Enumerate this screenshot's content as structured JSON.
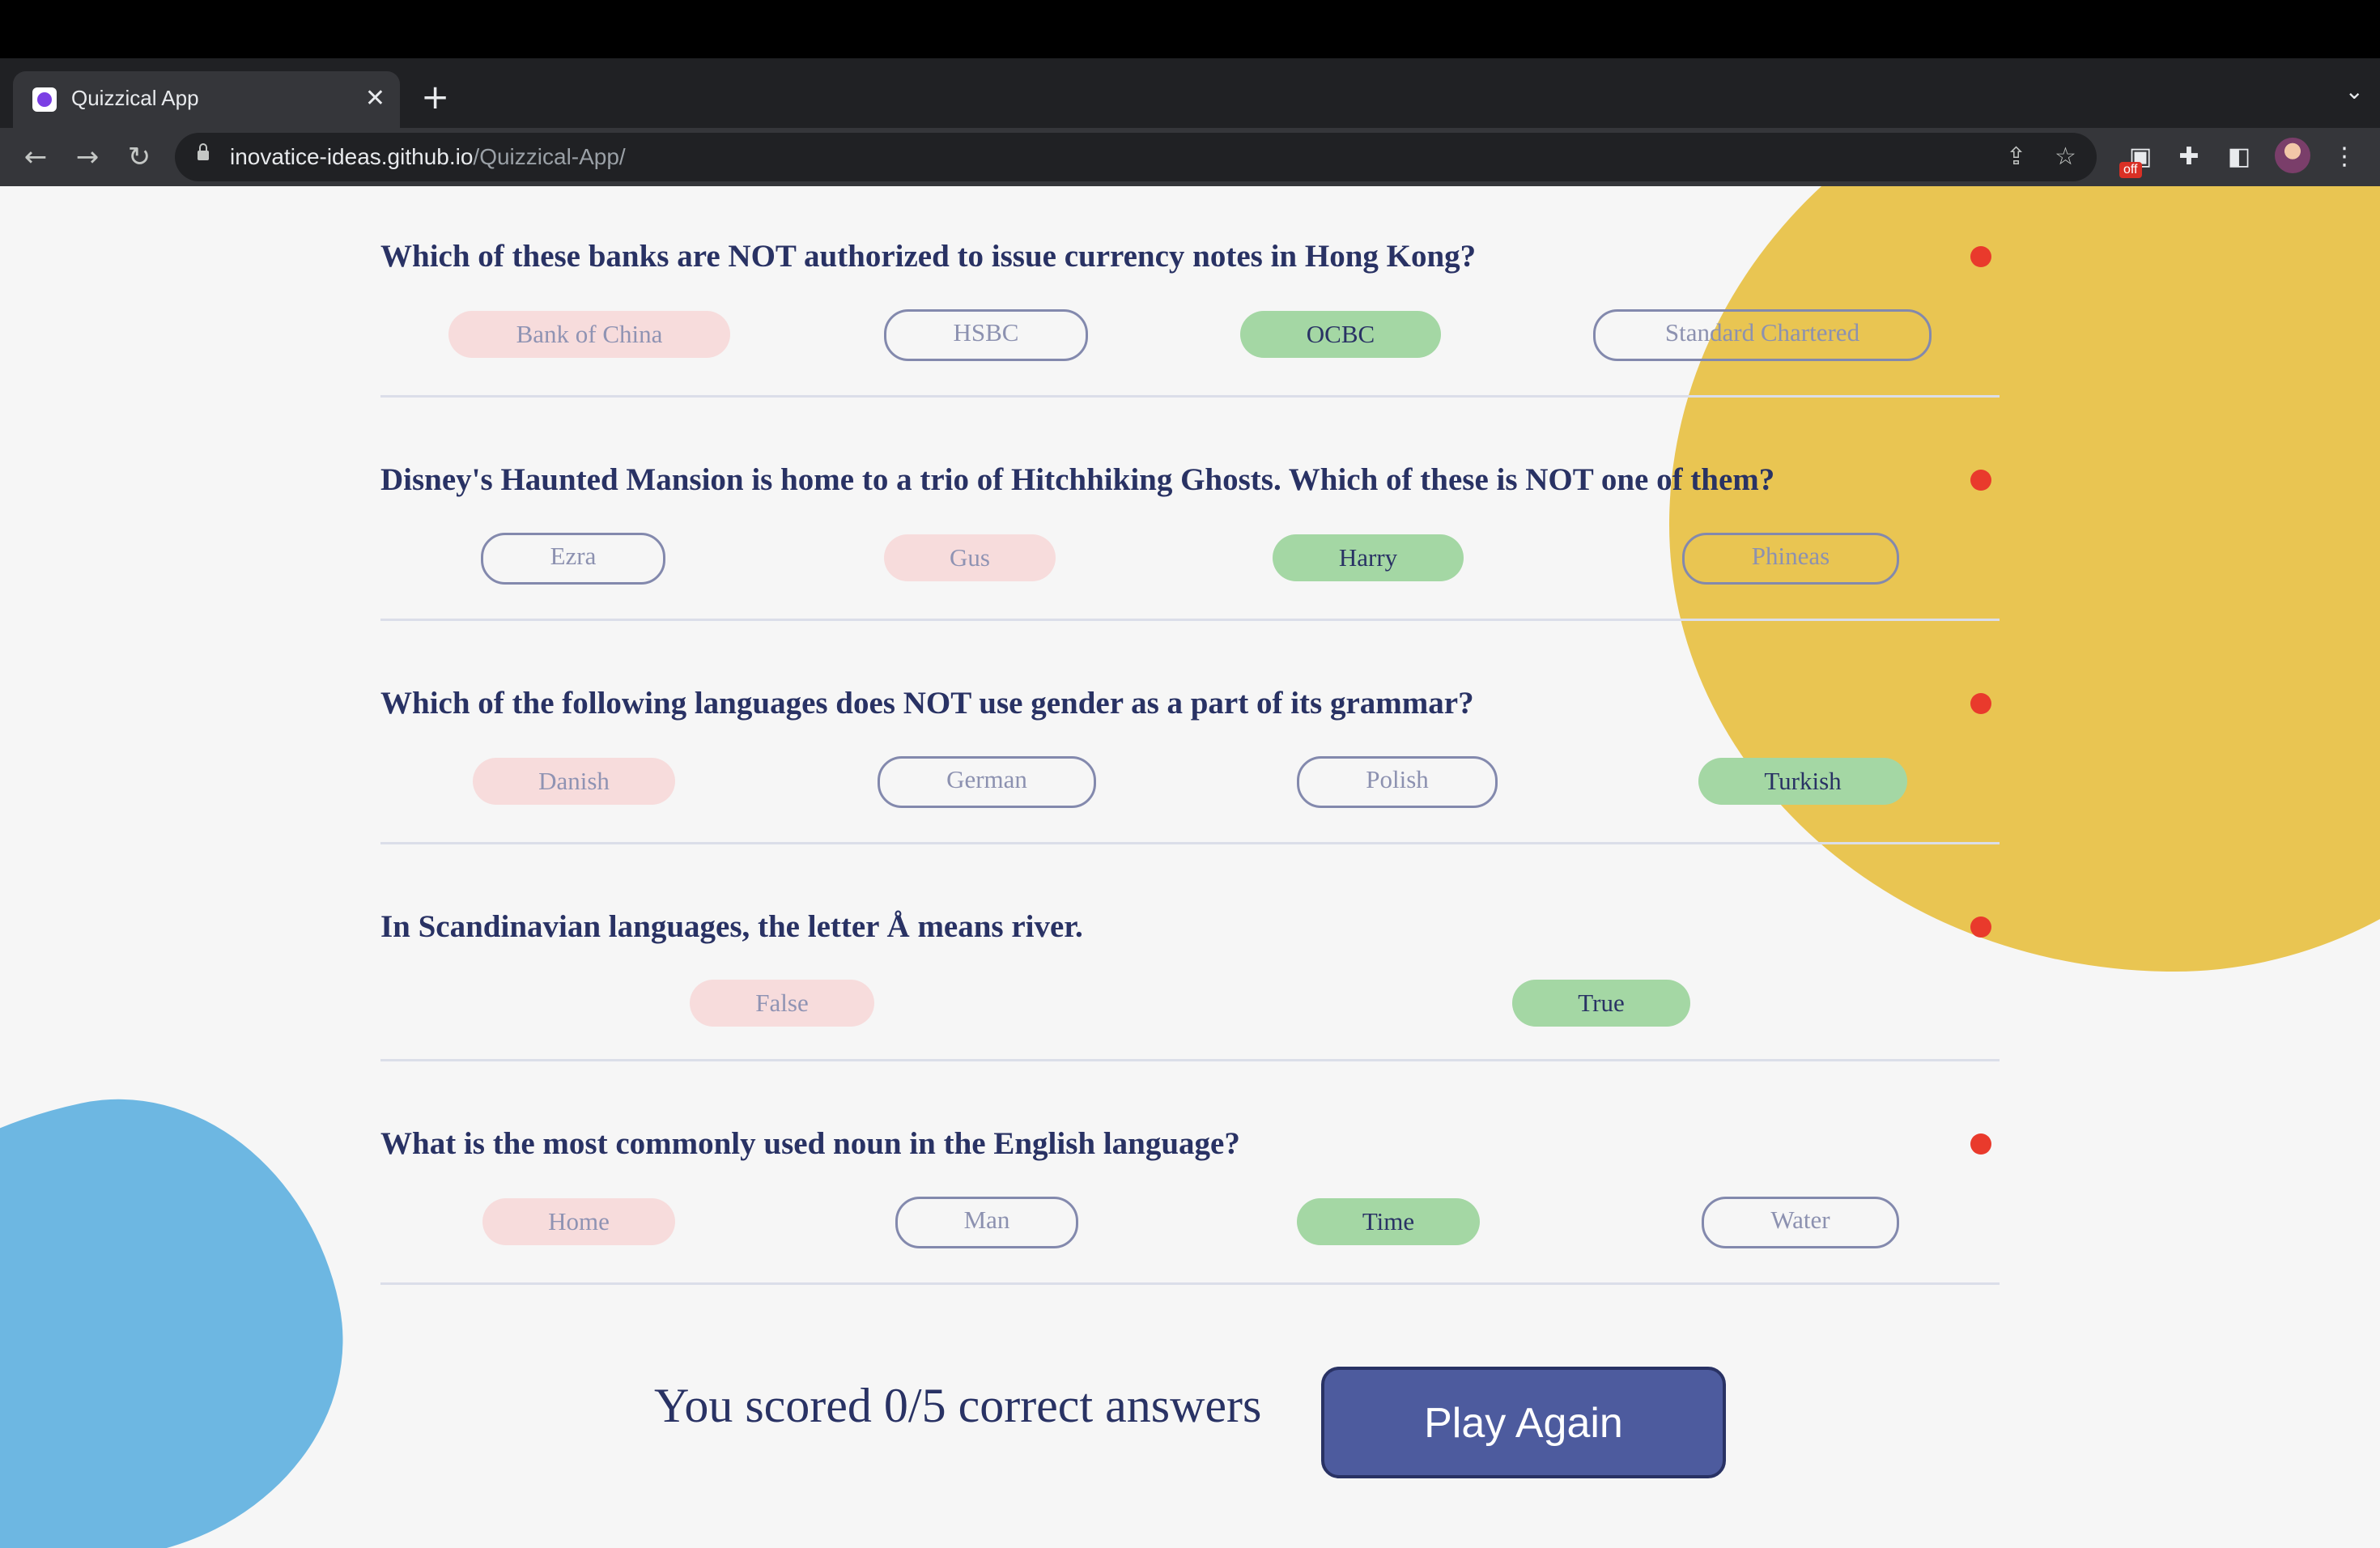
{
  "browser": {
    "tab_title": "Quizzical App",
    "new_tab_label": "+",
    "tab_close_label": "✕",
    "url_host": "inovatice-ideas.github.io",
    "url_path": "/Quizzical-App/",
    "extension_badge": "off"
  },
  "questions": [
    {
      "text": "Which of these banks are NOT authorized to issue currency notes in Hong Kong?",
      "answers": [
        {
          "label": "Bank of China",
          "state": "wrong"
        },
        {
          "label": "HSBC",
          "state": "neutral"
        },
        {
          "label": "OCBC",
          "state": "correct"
        },
        {
          "label": "Standard Chartered",
          "state": "neutral"
        }
      ]
    },
    {
      "text": "Disney's Haunted Mansion is home to a trio of Hitchhiking Ghosts. Which of these is NOT one of them?",
      "answers": [
        {
          "label": "Ezra",
          "state": "neutral"
        },
        {
          "label": "Gus",
          "state": "wrong"
        },
        {
          "label": "Harry",
          "state": "correct"
        },
        {
          "label": "Phineas",
          "state": "neutral"
        }
      ]
    },
    {
      "text": "Which of the following languages does NOT use gender as a part of its grammar?",
      "answers": [
        {
          "label": "Danish",
          "state": "wrong"
        },
        {
          "label": "German",
          "state": "neutral"
        },
        {
          "label": "Polish",
          "state": "neutral"
        },
        {
          "label": "Turkish",
          "state": "correct"
        }
      ]
    },
    {
      "text": "In Scandinavian languages, the letter Å means river.",
      "answers": [
        {
          "label": "False",
          "state": "wrong"
        },
        {
          "label": "True",
          "state": "correct"
        }
      ]
    },
    {
      "text": "What is the most commonly used noun in the English language?",
      "answers": [
        {
          "label": "Home",
          "state": "wrong"
        },
        {
          "label": "Man",
          "state": "neutral"
        },
        {
          "label": "Time",
          "state": "correct"
        },
        {
          "label": "Water",
          "state": "neutral"
        }
      ]
    }
  ],
  "result": {
    "score_text": "You scored 0/5 correct answers",
    "play_again_label": "Play Again"
  },
  "colors": {
    "correct": "#a4d7a4",
    "wrong": "#f7dcdc",
    "status_dot": "#e93a2c",
    "button": "#4d5b9e",
    "text": "#293264"
  }
}
